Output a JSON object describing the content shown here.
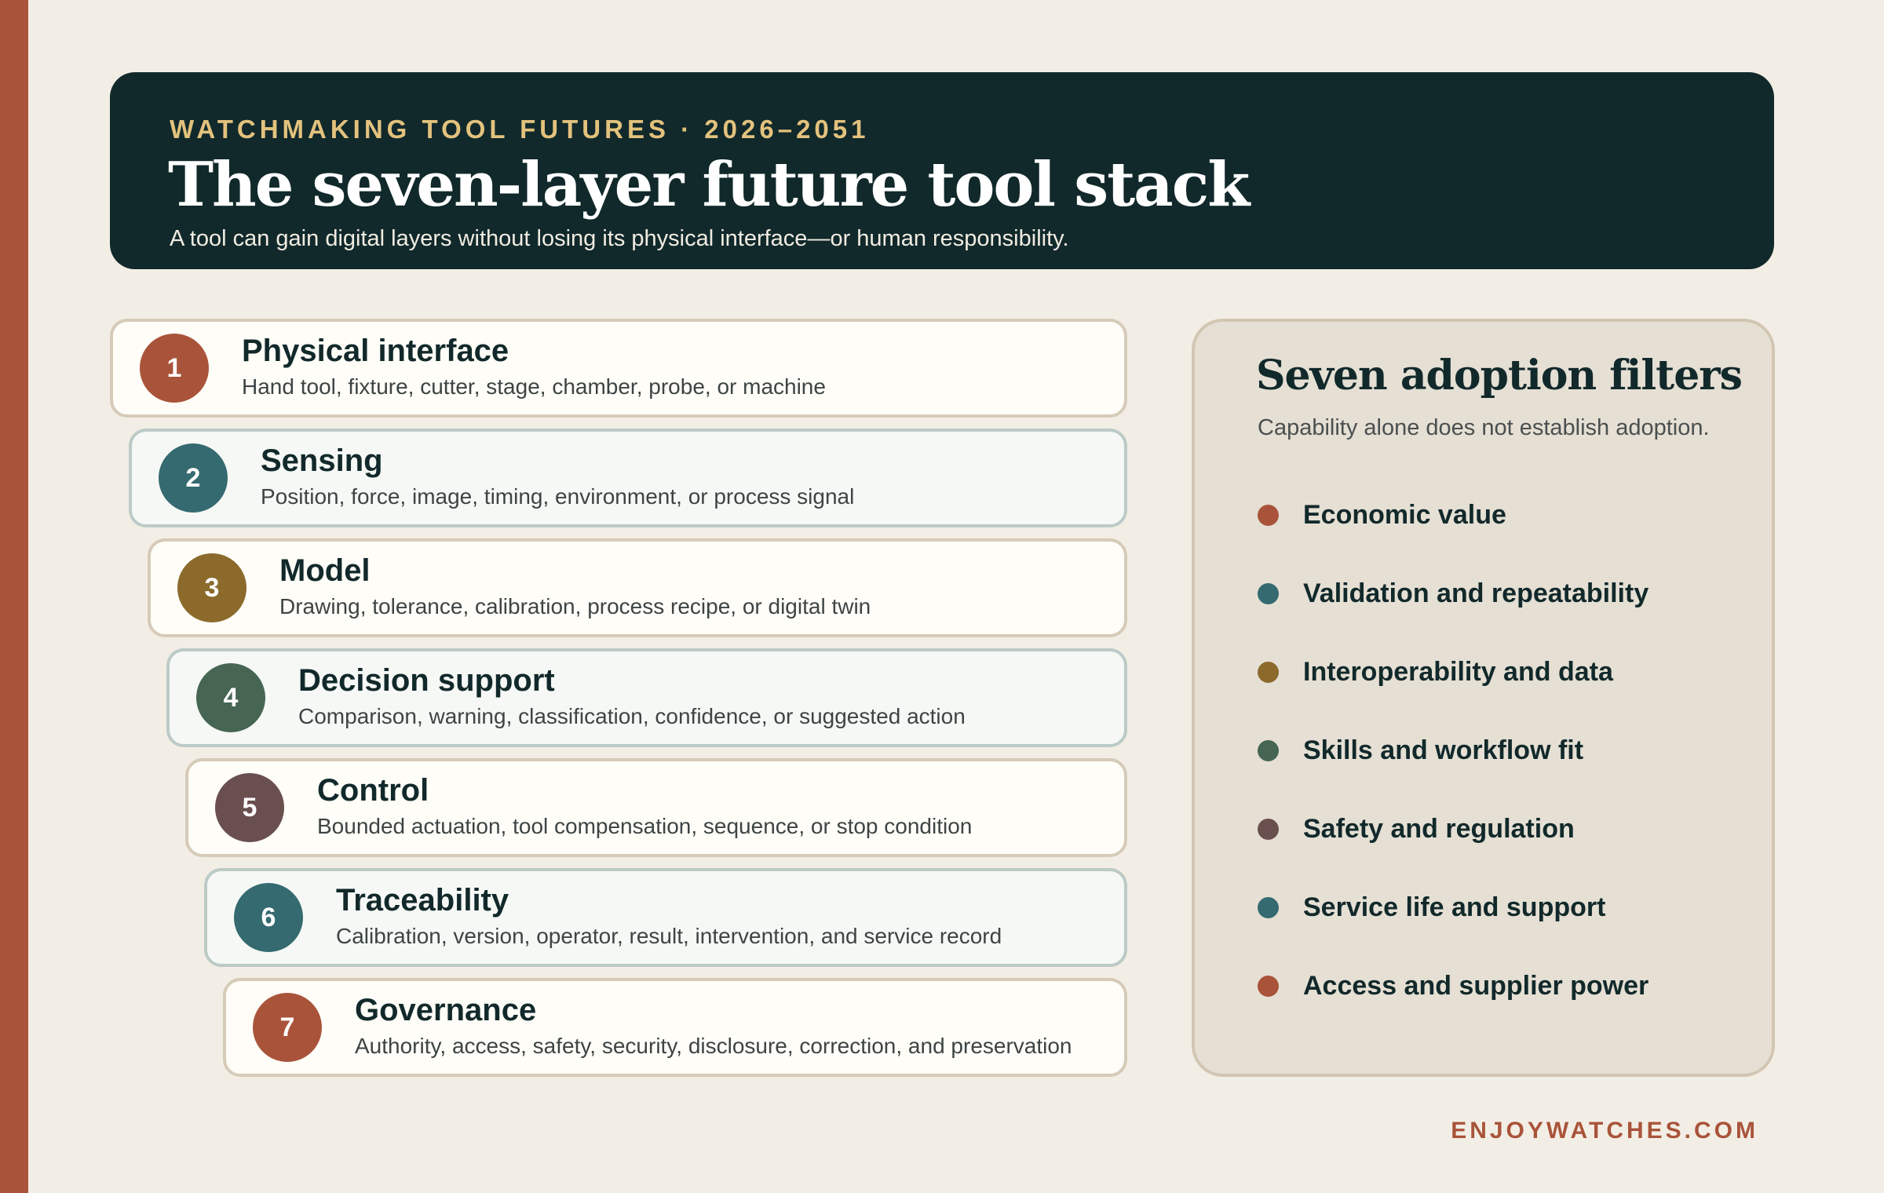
{
  "header": {
    "eyebrow": "WATCHMAKING TOOL FUTURES · 2026–2051",
    "title": "The seven-layer future tool stack",
    "subtitle": "A tool can gain digital layers without losing its physical interface—or human responsibility."
  },
  "layers": [
    {
      "number": "1",
      "title": "Physical interface",
      "description": "Hand tool, fixture, cutter, stage, chamber, probe, or machine",
      "color": "#a9543a"
    },
    {
      "number": "2",
      "title": "Sensing",
      "description": "Position, force, image, timing, environment, or process signal",
      "color": "#346a70"
    },
    {
      "number": "3",
      "title": "Model",
      "description": "Drawing, tolerance, calibration, process recipe, or digital twin",
      "color": "#8b6a2c"
    },
    {
      "number": "4",
      "title": "Decision support",
      "description": "Comparison, warning, classification, confidence, or suggested action",
      "color": "#466553"
    },
    {
      "number": "5",
      "title": "Control",
      "description": "Bounded actuation, tool compensation, sequence, or stop condition",
      "color": "#6a4f4f"
    },
    {
      "number": "6",
      "title": "Traceability",
      "description": "Calibration, version, operator, result, intervention, and service record",
      "color": "#346a70"
    },
    {
      "number": "7",
      "title": "Governance",
      "description": "Authority, access, safety, security, disclosure, correction, and preservation",
      "color": "#a9543a"
    }
  ],
  "filters": {
    "title": "Seven adoption filters",
    "subtitle": "Capability alone does not establish adoption.",
    "items": [
      {
        "label": "Economic value",
        "color": "#a9543a"
      },
      {
        "label": "Validation and repeatability",
        "color": "#346a70"
      },
      {
        "label": "Interoperability and data",
        "color": "#8b6a2c"
      },
      {
        "label": "Skills and workflow fit",
        "color": "#466553"
      },
      {
        "label": "Safety and regulation",
        "color": "#6a4f4f"
      },
      {
        "label": "Service life and support",
        "color": "#346a70"
      },
      {
        "label": "Access and supplier power",
        "color": "#a9543a"
      }
    ]
  },
  "footer": {
    "brand": "ENJOYWATCHES.COM"
  },
  "colors": {
    "background": "#f3eee5",
    "header_background": "#11292b",
    "accent": "#a9543a",
    "eyebrow": "#e3c27d"
  }
}
